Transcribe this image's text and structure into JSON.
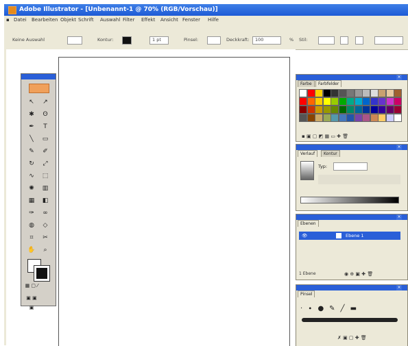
{
  "window": {
    "title": "Adobe Illustrator - [Unbenannt-1 @ 70% (RGB/Vorschau)]"
  },
  "menu": [
    "Datei",
    "Bearbeiten",
    "Objekt",
    "Schrift",
    "Auswahl",
    "Filter",
    "Effekt",
    "Ansicht",
    "Fenster",
    "Hilfe"
  ],
  "control_bar": {
    "labels": [
      "Keine Auswahl",
      "Kontur:",
      "1 pt",
      "Pinsel:",
      "Deckkraft:",
      "100",
      "%",
      "Stil:"
    ]
  },
  "toolbox": {
    "tools": [
      "selection-tool",
      "direct-selection-tool",
      "magic-wand-tool",
      "lasso-tool",
      "pen-tool",
      "type-tool",
      "line-tool",
      "rectangle-tool",
      "paintbrush-tool",
      "pencil-tool",
      "rotate-tool",
      "scale-tool",
      "warp-tool",
      "free-transform-tool",
      "symbol-sprayer-tool",
      "graph-tool",
      "mesh-tool",
      "gradient-tool",
      "eyedropper-tool",
      "blend-tool",
      "live-paint-tool",
      "live-paint-selection-tool",
      "slice-tool",
      "scissors-tool",
      "hand-tool",
      "zoom-tool"
    ]
  },
  "panels": {
    "swatches": {
      "tabs": [
        "Farbe",
        "Farbfelder"
      ]
    },
    "gradient": {
      "tabs": [
        "Verlauf",
        "Kontur"
      ],
      "type_label": "Typ:"
    },
    "layers": {
      "tabs": [
        "Ebenen"
      ],
      "layer_name": "Ebene 1",
      "footer": "1 Ebene"
    },
    "brushes": {
      "tabs": [
        "Pinsel"
      ]
    }
  },
  "colors": {
    "titlebar": "#1d5ad6",
    "chrome": "#ece9d8",
    "accent": "#2a5fd8"
  }
}
